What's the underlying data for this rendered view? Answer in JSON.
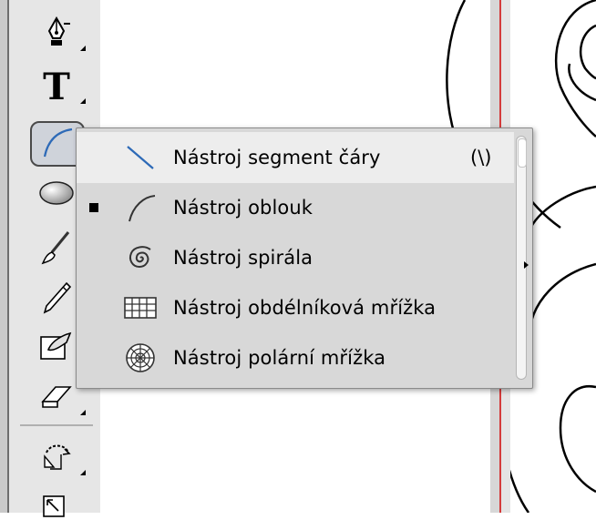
{
  "toolbar": {
    "tools": [
      {
        "name": "pen-tool-icon",
        "has_flyout": true
      },
      {
        "name": "type-tool-icon",
        "label": "T",
        "has_flyout": true
      },
      {
        "name": "line-segment-tool-icon",
        "has_flyout": true,
        "active": true
      },
      {
        "name": "ellipse-tool-icon",
        "has_flyout": true
      },
      {
        "name": "paintbrush-tool-icon",
        "has_flyout": true
      },
      {
        "name": "pencil-tool-icon",
        "has_flyout": true
      },
      {
        "name": "blob-brush-tool-icon",
        "has_flyout": true
      },
      {
        "name": "eraser-tool-icon",
        "has_flyout": true
      },
      {
        "name": "rotate-tool-icon",
        "has_flyout": true
      },
      {
        "name": "scale-tool-icon",
        "has_flyout": true
      }
    ]
  },
  "flyout_menu": {
    "items": [
      {
        "label": "Nástroj segment čáry",
        "shortcut": "(\\)",
        "icon": "line-segment-icon",
        "checked": false,
        "highlighted": true
      },
      {
        "label": "Nástroj oblouk",
        "shortcut": "",
        "icon": "arc-icon",
        "checked": true,
        "highlighted": false
      },
      {
        "label": "Nástroj spirála",
        "shortcut": "",
        "icon": "spiral-icon",
        "checked": false,
        "highlighted": false
      },
      {
        "label": "Nástroj obdélníková mřížka",
        "shortcut": "",
        "icon": "rectangular-grid-icon",
        "checked": false,
        "highlighted": false
      },
      {
        "label": "Nástroj polární mřížka",
        "shortcut": "",
        "icon": "polar-grid-icon",
        "checked": false,
        "highlighted": false
      }
    ]
  },
  "colors": {
    "toolbar_bg": "#e6e6e6",
    "menu_bg": "#d8d8d8",
    "menu_highlight": "#ededed",
    "guide": "#d43b3b"
  }
}
